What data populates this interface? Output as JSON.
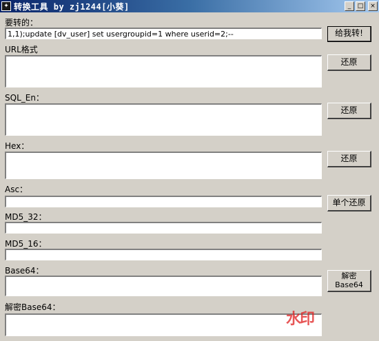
{
  "window": {
    "title": "转换工具 by zj1244[小葵]",
    "icon": "app-icon",
    "minimize_glyph": "_",
    "maximize_glyph": "□",
    "close_glyph": "×"
  },
  "fields": {
    "input": {
      "label": "要转的：",
      "value": "1,1);update [dv_user] set usergroupid=1 where userid=2;--"
    },
    "url": {
      "label": "URL格式",
      "value": ""
    },
    "sql_en": {
      "label": "SQL_En：",
      "value": ""
    },
    "hex": {
      "label": "Hex：",
      "value": ""
    },
    "asc": {
      "label": "Asc：",
      "value": ""
    },
    "md5_32": {
      "label": "MD5_32：",
      "value": ""
    },
    "md5_16": {
      "label": "MD5_16：",
      "value": ""
    },
    "base64": {
      "label": "Base64：",
      "value": ""
    },
    "decode_base64": {
      "label": "解密Base64：",
      "value": ""
    }
  },
  "buttons": {
    "convert": "给我转!",
    "restore_url": "还原",
    "restore_sql": "还原",
    "restore_hex": "还原",
    "restore_single": "单个还原",
    "decrypt_line1": "解密",
    "decrypt_line2": "Base64"
  },
  "watermark": "水印"
}
